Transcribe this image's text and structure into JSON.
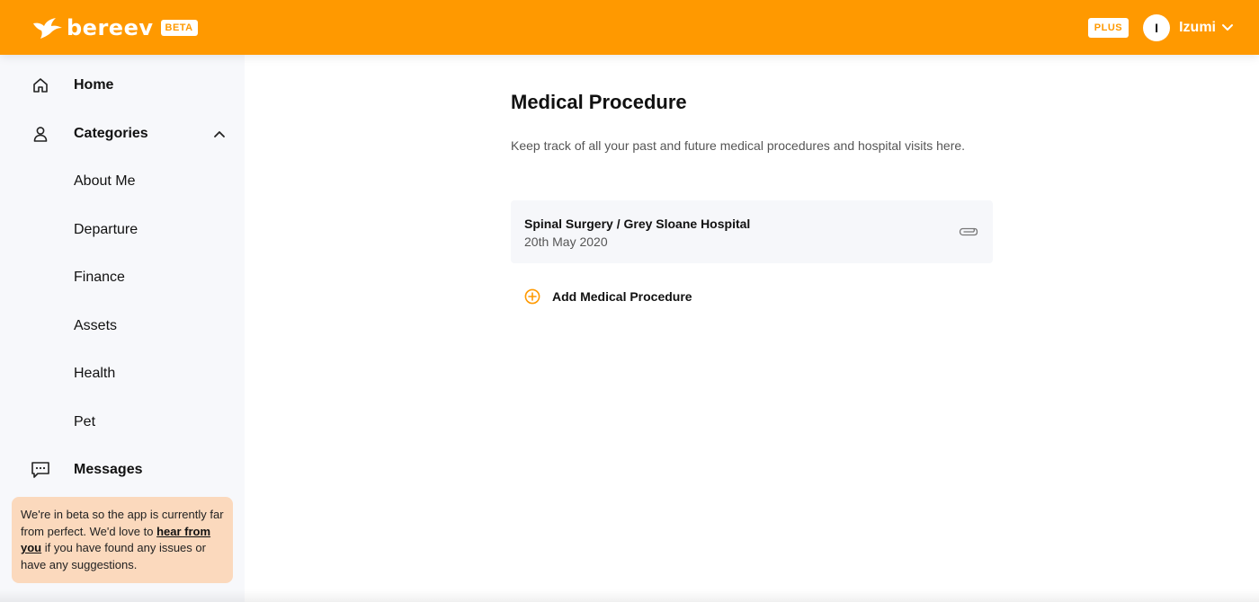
{
  "header": {
    "brand_name": "bereev",
    "beta_label": "BETA",
    "plus_label": "PLUS",
    "avatar_initial": "I",
    "user_name": "Izumi",
    "background_color": "#ff9900"
  },
  "sidebar": {
    "items": [
      {
        "label": "Home",
        "icon": "home-icon"
      },
      {
        "label": "Categories",
        "icon": "user-icon",
        "expanded": true
      },
      {
        "label": "About Me"
      },
      {
        "label": "Departure"
      },
      {
        "label": "Finance"
      },
      {
        "label": "Assets"
      },
      {
        "label": "Health"
      },
      {
        "label": "Pet"
      },
      {
        "label": "Messages",
        "icon": "chat-icon"
      }
    ],
    "beta_note": {
      "text_before": "We're in beta so the app is currently far from perfect. We'd love to ",
      "link_text": "hear from you",
      "text_after": " if you have found any issues or have any suggestions."
    }
  },
  "main": {
    "title": "Medical Procedure",
    "description": "Keep track of all your past and future medical procedures and hospital visits here.",
    "procedures": [
      {
        "title": "Spinal Surgery / Grey Sloane Hospital",
        "date": "20th May 2020",
        "attachment_icon": "paperclip-icon"
      }
    ],
    "add_label": "Add Medical Procedure"
  },
  "colors": {
    "accent": "#ff9900",
    "sidebar_bg": "#f7f8fb",
    "note_bg": "#fbd9bd",
    "card_bg": "#f6f7fa"
  }
}
